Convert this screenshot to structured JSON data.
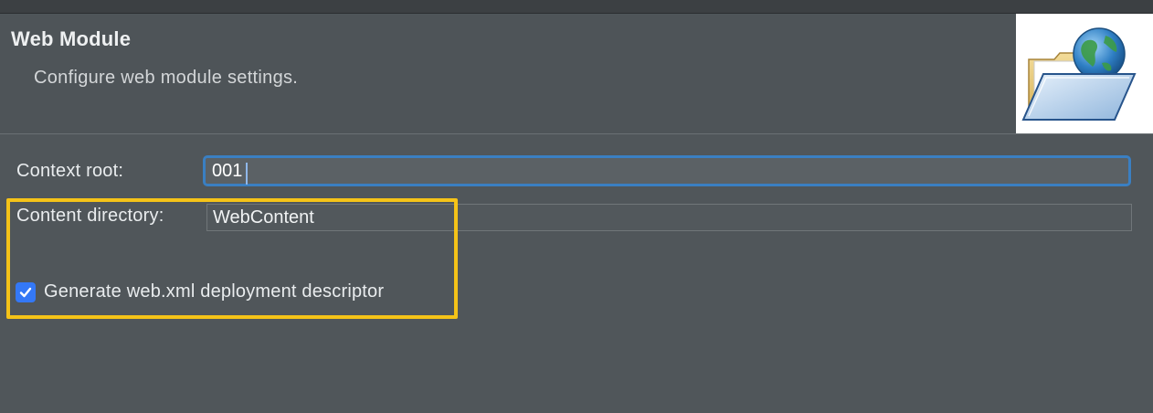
{
  "header": {
    "title": "Web Module",
    "description": "Configure web module settings."
  },
  "form": {
    "context_root": {
      "label": "Context root:",
      "value": "001"
    },
    "content_directory": {
      "label": "Content directory:",
      "value": "WebContent"
    },
    "generate_descriptor": {
      "label": "Generate web.xml deployment descriptor",
      "checked": true
    }
  },
  "icons": {
    "banner": "folder-globe-icon",
    "check": "checkmark-icon"
  },
  "colors": {
    "background": "#50565a",
    "focus_ring": "#3a7fc2",
    "checkbox": "#3478f6",
    "highlight": "#f5c318"
  }
}
